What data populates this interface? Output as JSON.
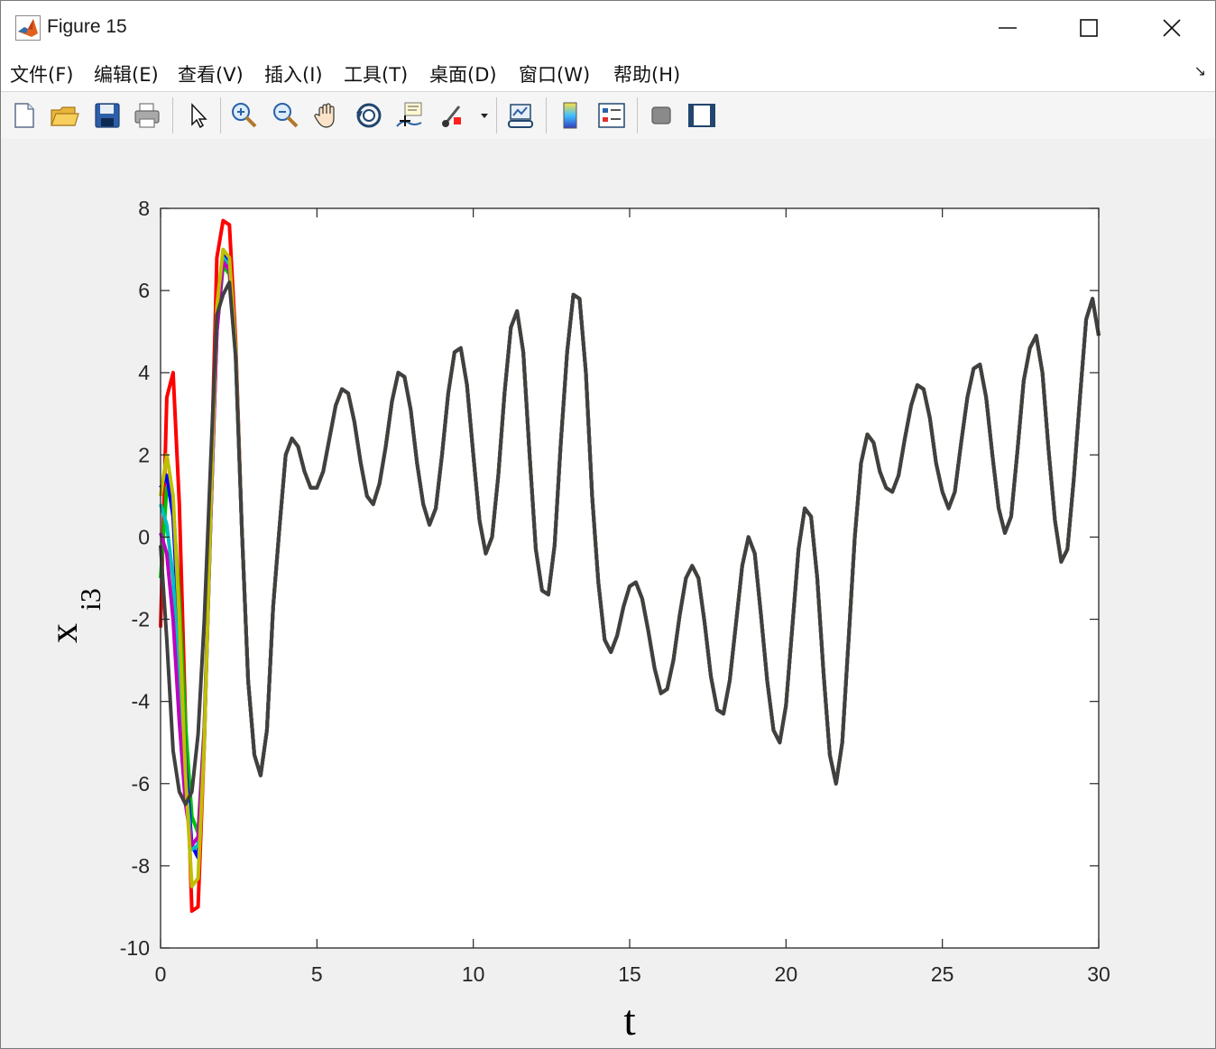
{
  "window": {
    "title": "Figure 15",
    "controls": {
      "minimize": "minimize-icon",
      "maximize": "maximize-icon",
      "close": "close-icon"
    }
  },
  "menu": {
    "items": [
      "文件(F)",
      "编辑(E)",
      "查看(V)",
      "插入(I)",
      "工具(T)",
      "桌面(D)",
      "窗口(W)",
      "帮助(H)"
    ],
    "corner_icon": "dock-arrow-icon"
  },
  "toolbar": {
    "tools": [
      "new-figure-icon",
      "open-file-icon",
      "save-icon",
      "print-icon",
      "select-arrow-icon",
      "zoom-in-icon",
      "zoom-out-icon",
      "pan-hand-icon",
      "rotate-3d-icon",
      "data-cursor-icon",
      "brush-icon",
      "link-plot-icon",
      "colorbar-icon",
      "legend-icon",
      "hide-plot-tools-icon",
      "show-plot-tools-icon"
    ]
  },
  "colors": {
    "axes_bg": "#ffffff",
    "window_bg": "#f0f0f0",
    "series": [
      "#ff0000",
      "#00c000",
      "#0000ff",
      "#00bfbf",
      "#bf00bf",
      "#bfbf00",
      "#404040"
    ]
  },
  "chart_data": {
    "type": "line",
    "title": "",
    "xlabel": "t",
    "ylabel_main": "x",
    "ylabel_sub": "i3",
    "xlim": [
      0,
      30
    ],
    "ylim": [
      -10,
      8
    ],
    "xticks": [
      0,
      5,
      10,
      15,
      20,
      25,
      30
    ],
    "yticks": [
      -10,
      -8,
      -6,
      -4,
      -2,
      0,
      2,
      4,
      6,
      8
    ],
    "grid": false,
    "x": [
      0.0,
      0.2,
      0.4,
      0.6,
      0.8,
      1.0,
      1.2,
      1.4,
      1.6,
      1.8,
      2.0,
      2.2,
      2.4,
      2.6,
      2.8,
      3.0,
      3.2,
      3.4,
      3.6,
      3.8,
      4.0,
      4.2,
      4.4,
      4.6,
      4.8,
      5.0,
      5.2,
      5.4,
      5.6,
      5.8,
      6.0,
      6.2,
      6.4,
      6.6,
      6.8,
      7.0,
      7.2,
      7.4,
      7.6,
      7.8,
      8.0,
      8.2,
      8.4,
      8.6,
      8.8,
      9.0,
      9.2,
      9.4,
      9.6,
      9.8,
      10.0,
      10.2,
      10.4,
      10.6,
      10.8,
      11.0,
      11.2,
      11.4,
      11.6,
      11.8,
      12.0,
      12.2,
      12.4,
      12.6,
      12.8,
      13.0,
      13.2,
      13.4,
      13.6,
      13.8,
      14.0,
      14.2,
      14.4,
      14.6,
      14.8,
      15.0,
      15.2,
      15.4,
      15.6,
      15.8,
      16.0,
      16.2,
      16.4,
      16.6,
      16.8,
      17.0,
      17.2,
      17.4,
      17.6,
      17.8,
      18.0,
      18.2,
      18.4,
      18.6,
      18.8,
      19.0,
      19.2,
      19.4,
      19.6,
      19.8,
      20.0,
      20.2,
      20.4,
      20.6,
      20.8,
      21.0,
      21.2,
      21.4,
      21.6,
      21.8,
      22.0,
      22.2,
      22.4,
      22.6,
      22.8,
      23.0,
      23.2,
      23.4,
      23.6,
      23.8,
      24.0,
      24.2,
      24.4,
      24.6,
      24.8,
      25.0,
      25.2,
      25.4,
      25.6,
      25.8,
      26.0,
      26.2,
      26.4,
      26.6,
      26.8,
      27.0,
      27.2,
      27.4,
      27.6,
      27.8,
      28.0,
      28.2,
      28.4,
      28.6,
      28.8,
      29.0,
      29.2,
      29.4,
      29.6,
      29.8,
      30.0
    ],
    "series": [
      {
        "values": [
          -2.2,
          3.4,
          4.0,
          0.8,
          -4.5,
          -9.1,
          -9.0,
          -5.0,
          1.0,
          6.8,
          7.7,
          7.6,
          4.8,
          0.2,
          -3.5,
          -5.3,
          -5.8,
          -4.7,
          -1.7,
          0.2,
          2.0,
          2.4,
          2.2,
          1.6,
          1.2,
          1.2,
          1.6,
          2.4,
          3.2,
          3.6,
          3.5,
          2.8,
          1.8,
          1.0,
          0.8,
          1.3,
          2.2,
          3.3,
          4.0,
          3.9,
          3.1,
          1.8,
          0.8,
          0.3,
          0.7,
          2.0,
          3.5,
          4.5,
          4.6,
          3.7,
          2.0,
          0.4,
          -0.4,
          0.0,
          1.5,
          3.5,
          5.1,
          5.5,
          4.5,
          2.0,
          -0.3,
          -1.3,
          -1.4,
          -0.2,
          2.3,
          4.5,
          5.9,
          5.8,
          4.0,
          1.0,
          -1.1,
          -2.5,
          -2.8,
          -2.4,
          -1.7,
          -1.2,
          -1.1,
          -1.5,
          -2.3,
          -3.2,
          -3.8,
          -3.7,
          -3.0,
          -1.9,
          -1.0,
          -0.7,
          -1.0,
          -2.1,
          -3.4,
          -4.2,
          -4.3,
          -3.5,
          -2.1,
          -0.7,
          0.0,
          -0.4,
          -1.9,
          -3.5,
          -4.7,
          -5.0,
          -4.1,
          -2.2,
          -0.3,
          0.7,
          0.5,
          -1.0,
          -3.3,
          -5.3,
          -6.0,
          -5.0,
          -2.5,
          0.0,
          1.8,
          2.5,
          2.3,
          1.6,
          1.2,
          1.1,
          1.5,
          2.4,
          3.2,
          3.7,
          3.6,
          2.9,
          1.8,
          1.1,
          0.7,
          1.1,
          2.3,
          3.4,
          4.1,
          4.2,
          3.4,
          2.0,
          0.7,
          0.1,
          0.5,
          2.1,
          3.8,
          4.6,
          4.9,
          4.0,
          2.1,
          0.4,
          -0.6,
          -0.3,
          1.4,
          3.4,
          5.3,
          5.8,
          4.9
        ]
      },
      {
        "values": [
          -1.0,
          1.2,
          0.8,
          -1.5,
          -4.6,
          -6.8,
          -7.2,
          -4.6,
          0.5,
          5.0,
          6.6,
          6.4,
          4.4,
          0.2,
          -3.5,
          -5.3,
          -5.8,
          -4.7,
          -1.7,
          0.2,
          2.0,
          2.4,
          2.2,
          1.6,
          1.2,
          1.2,
          1.6,
          2.4,
          3.2,
          3.6,
          3.5,
          2.8,
          1.8,
          1.0,
          0.8,
          1.3,
          2.2,
          3.3,
          4.0,
          3.9,
          3.1,
          1.8,
          0.8,
          0.3,
          0.7,
          2.0,
          3.5,
          4.5,
          4.6,
          3.7,
          2.0,
          0.4,
          -0.4,
          0.0,
          1.5,
          3.5,
          5.1,
          5.5,
          4.5,
          2.0,
          -0.3,
          -1.3,
          -1.4,
          -0.2,
          2.3,
          4.5,
          5.9,
          5.8,
          4.0,
          1.0,
          -1.1,
          -2.5,
          -2.8,
          -2.4,
          -1.7,
          -1.2,
          -1.1,
          -1.5,
          -2.3,
          -3.2,
          -3.8,
          -3.7,
          -3.0,
          -1.9,
          -1.0,
          -0.7,
          -1.0,
          -2.1,
          -3.4,
          -4.2,
          -4.3,
          -3.5,
          -2.1,
          -0.7,
          0.0,
          -0.4,
          -1.9,
          -3.5,
          -4.7,
          -5.0,
          -4.1,
          -2.2,
          -0.3,
          0.7,
          0.5,
          -1.0,
          -3.3,
          -5.3,
          -6.0,
          -5.0,
          -2.5,
          0.0,
          1.8,
          2.5,
          2.3,
          1.6,
          1.2,
          1.1,
          1.5,
          2.4,
          3.2,
          3.7,
          3.6,
          2.9,
          1.8,
          1.1,
          0.7,
          1.1,
          2.3,
          3.4,
          4.1,
          4.2,
          3.4,
          2.0,
          0.7,
          0.1,
          0.5,
          2.1,
          3.8,
          4.6,
          4.9,
          4.0,
          2.1,
          0.4,
          -0.6,
          -0.3,
          1.4,
          3.4,
          5.3,
          5.8,
          4.9
        ]
      },
      {
        "values": [
          1.2,
          1.5,
          0.5,
          -2.5,
          -5.5,
          -7.5,
          -7.8,
          -4.9,
          0.4,
          5.2,
          6.9,
          6.7,
          4.6,
          0.2,
          -3.5,
          -5.3,
          -5.8,
          -4.7,
          -1.7,
          0.2,
          2.0,
          2.4,
          2.2,
          1.6,
          1.2,
          1.2,
          1.6,
          2.4,
          3.2,
          3.6,
          3.5,
          2.8,
          1.8,
          1.0,
          0.8,
          1.3,
          2.2,
          3.3,
          4.0,
          3.9,
          3.1,
          1.8,
          0.8,
          0.3,
          0.7,
          2.0,
          3.5,
          4.5,
          4.6,
          3.7,
          2.0,
          0.4,
          -0.4,
          0.0,
          1.5,
          3.5,
          5.1,
          5.5,
          4.5,
          2.0,
          -0.3,
          -1.3,
          -1.4,
          -0.2,
          2.3,
          4.5,
          5.9,
          5.8,
          4.0,
          1.0,
          -1.1,
          -2.5,
          -2.8,
          -2.4,
          -1.7,
          -1.2,
          -1.1,
          -1.5,
          -2.3,
          -3.2,
          -3.8,
          -3.7,
          -3.0,
          -1.9,
          -1.0,
          -0.7,
          -1.0,
          -2.1,
          -3.4,
          -4.2,
          -4.3,
          -3.5,
          -2.1,
          -0.7,
          0.0,
          -0.4,
          -1.9,
          -3.5,
          -4.7,
          -5.0,
          -4.1,
          -2.2,
          -0.3,
          0.7,
          0.5,
          -1.0,
          -3.3,
          -5.3,
          -6.0,
          -5.0,
          -2.5,
          0.0,
          1.8,
          2.5,
          2.3,
          1.6,
          1.2,
          1.1,
          1.5,
          2.4,
          3.2,
          3.7,
          3.6,
          2.9,
          1.8,
          1.1,
          0.7,
          1.1,
          2.3,
          3.4,
          4.1,
          4.2,
          3.4,
          2.0,
          0.7,
          0.1,
          0.5,
          2.1,
          3.8,
          4.6,
          4.9,
          4.0,
          2.1,
          0.4,
          -0.6,
          -0.3,
          1.4,
          3.4,
          5.3,
          5.8,
          4.9
        ]
      },
      {
        "values": [
          0.8,
          0.3,
          -1.0,
          -3.5,
          -6.0,
          -7.6,
          -7.5,
          -4.8,
          0.4,
          5.1,
          6.8,
          6.6,
          4.5,
          0.2,
          -3.5,
          -5.3,
          -5.8,
          -4.7,
          -1.7,
          0.2,
          2.0,
          2.4,
          2.2,
          1.6,
          1.2,
          1.2,
          1.6,
          2.4,
          3.2,
          3.6,
          3.5,
          2.8,
          1.8,
          1.0,
          0.8,
          1.3,
          2.2,
          3.3,
          4.0,
          3.9,
          3.1,
          1.8,
          0.8,
          0.3,
          0.7,
          2.0,
          3.5,
          4.5,
          4.6,
          3.7,
          2.0,
          0.4,
          -0.4,
          0.0,
          1.5,
          3.5,
          5.1,
          5.5,
          4.5,
          2.0,
          -0.3,
          -1.3,
          -1.4,
          -0.2,
          2.3,
          4.5,
          5.9,
          5.8,
          4.0,
          1.0,
          -1.1,
          -2.5,
          -2.8,
          -2.4,
          -1.7,
          -1.2,
          -1.1,
          -1.5,
          -2.3,
          -3.2,
          -3.8,
          -3.7,
          -3.0,
          -1.9,
          -1.0,
          -0.7,
          -1.0,
          -2.1,
          -3.4,
          -4.2,
          -4.3,
          -3.5,
          -2.1,
          -0.7,
          0.0,
          -0.4,
          -1.9,
          -3.5,
          -4.7,
          -5.0,
          -4.1,
          -2.2,
          -0.3,
          0.7,
          0.5,
          -1.0,
          -3.3,
          -5.3,
          -6.0,
          -5.0,
          -2.5,
          0.0,
          1.8,
          2.5,
          2.3,
          1.6,
          1.2,
          1.1,
          1.5,
          2.4,
          3.2,
          3.7,
          3.6,
          2.9,
          1.8,
          1.1,
          0.7,
          1.1,
          2.3,
          3.4,
          4.1,
          4.2,
          3.4,
          2.0,
          0.7,
          0.1,
          0.5,
          2.1,
          3.8,
          4.6,
          4.9,
          4.0,
          2.1,
          0.4,
          -0.6,
          -0.3,
          1.4,
          3.4,
          5.3,
          5.8,
          4.9
        ]
      },
      {
        "values": [
          0.1,
          -0.4,
          -2.0,
          -4.5,
          -6.5,
          -7.5,
          -7.3,
          -4.7,
          0.4,
          5.0,
          6.7,
          6.5,
          4.5,
          0.2,
          -3.5,
          -5.3,
          -5.8,
          -4.7,
          -1.7,
          0.2,
          2.0,
          2.4,
          2.2,
          1.6,
          1.2,
          1.2,
          1.6,
          2.4,
          3.2,
          3.6,
          3.5,
          2.8,
          1.8,
          1.0,
          0.8,
          1.3,
          2.2,
          3.3,
          4.0,
          3.9,
          3.1,
          1.8,
          0.8,
          0.3,
          0.7,
          2.0,
          3.5,
          4.5,
          4.6,
          3.7,
          2.0,
          0.4,
          -0.4,
          0.0,
          1.5,
          3.5,
          5.1,
          5.5,
          4.5,
          2.0,
          -0.3,
          -1.3,
          -1.4,
          -0.2,
          2.3,
          4.5,
          5.9,
          5.8,
          4.0,
          1.0,
          -1.1,
          -2.5,
          -2.8,
          -2.4,
          -1.7,
          -1.2,
          -1.1,
          -1.5,
          -2.3,
          -3.2,
          -3.8,
          -3.7,
          -3.0,
          -1.9,
          -1.0,
          -0.7,
          -1.0,
          -2.1,
          -3.4,
          -4.2,
          -4.3,
          -3.5,
          -2.1,
          -0.7,
          0.0,
          -0.4,
          -1.9,
          -3.5,
          -4.7,
          -5.0,
          -4.1,
          -2.2,
          -0.3,
          0.7,
          0.5,
          -1.0,
          -3.3,
          -5.3,
          -6.0,
          -5.0,
          -2.5,
          0.0,
          1.8,
          2.5,
          2.3,
          1.6,
          1.2,
          1.1,
          1.5,
          2.4,
          3.2,
          3.7,
          3.6,
          2.9,
          1.8,
          1.1,
          0.7,
          1.1,
          2.3,
          3.4,
          4.1,
          4.2,
          3.4,
          2.0,
          0.7,
          0.1,
          0.5,
          2.1,
          3.8,
          4.6,
          4.9,
          4.0,
          2.1,
          0.4,
          -0.6,
          -0.3,
          1.4,
          3.4,
          5.3,
          5.8,
          4.9
        ]
      },
      {
        "values": [
          1.0,
          2.0,
          1.0,
          -2.0,
          -5.8,
          -8.5,
          -8.3,
          -5.0,
          0.6,
          5.6,
          7.0,
          6.8,
          4.6,
          0.2,
          -3.5,
          -5.3,
          -5.8,
          -4.7,
          -1.7,
          0.2,
          2.0,
          2.4,
          2.2,
          1.6,
          1.2,
          1.2,
          1.6,
          2.4,
          3.2,
          3.6,
          3.5,
          2.8,
          1.8,
          1.0,
          0.8,
          1.3,
          2.2,
          3.3,
          4.0,
          3.9,
          3.1,
          1.8,
          0.8,
          0.3,
          0.7,
          2.0,
          3.5,
          4.5,
          4.6,
          3.7,
          2.0,
          0.4,
          -0.4,
          0.0,
          1.5,
          3.5,
          5.1,
          5.5,
          4.5,
          2.0,
          -0.3,
          -1.3,
          -1.4,
          -0.2,
          2.3,
          4.5,
          5.9,
          5.8,
          4.0,
          1.0,
          -1.1,
          -2.5,
          -2.8,
          -2.4,
          -1.7,
          -1.2,
          -1.1,
          -1.5,
          -2.3,
          -3.2,
          -3.8,
          -3.7,
          -3.0,
          -1.9,
          -1.0,
          -0.7,
          -1.0,
          -2.1,
          -3.4,
          -4.2,
          -4.3,
          -3.5,
          -2.1,
          -0.7,
          0.0,
          -0.4,
          -1.9,
          -3.5,
          -4.7,
          -5.0,
          -4.1,
          -2.2,
          -0.3,
          0.7,
          0.5,
          -1.0,
          -3.3,
          -5.3,
          -6.0,
          -5.0,
          -2.5,
          0.0,
          1.8,
          2.5,
          2.3,
          1.6,
          1.2,
          1.1,
          1.5,
          2.4,
          3.2,
          3.7,
          3.6,
          2.9,
          1.8,
          1.1,
          0.7,
          1.1,
          2.3,
          3.4,
          4.1,
          4.2,
          3.4,
          2.0,
          0.7,
          0.1,
          0.5,
          2.1,
          3.8,
          4.6,
          4.9,
          4.0,
          2.1,
          0.4,
          -0.6,
          -0.3,
          1.4,
          3.4,
          5.3,
          5.8,
          4.9
        ]
      },
      {
        "values": [
          -0.2,
          -2.5,
          -5.2,
          -6.2,
          -6.5,
          -6.2,
          -4.8,
          -2.0,
          1.8,
          5.4,
          5.9,
          6.2,
          4.4,
          0.2,
          -3.5,
          -5.3,
          -5.8,
          -4.7,
          -1.7,
          0.2,
          2.0,
          2.4,
          2.2,
          1.6,
          1.2,
          1.2,
          1.6,
          2.4,
          3.2,
          3.6,
          3.5,
          2.8,
          1.8,
          1.0,
          0.8,
          1.3,
          2.2,
          3.3,
          4.0,
          3.9,
          3.1,
          1.8,
          0.8,
          0.3,
          0.7,
          2.0,
          3.5,
          4.5,
          4.6,
          3.7,
          2.0,
          0.4,
          -0.4,
          0.0,
          1.5,
          3.5,
          5.1,
          5.5,
          4.5,
          2.0,
          -0.3,
          -1.3,
          -1.4,
          -0.2,
          2.3,
          4.5,
          5.9,
          5.8,
          4.0,
          1.0,
          -1.1,
          -2.5,
          -2.8,
          -2.4,
          -1.7,
          -1.2,
          -1.1,
          -1.5,
          -2.3,
          -3.2,
          -3.8,
          -3.7,
          -3.0,
          -1.9,
          -1.0,
          -0.7,
          -1.0,
          -2.1,
          -3.4,
          -4.2,
          -4.3,
          -3.5,
          -2.1,
          -0.7,
          0.0,
          -0.4,
          -1.9,
          -3.5,
          -4.7,
          -5.0,
          -4.1,
          -2.2,
          -0.3,
          0.7,
          0.5,
          -1.0,
          -3.3,
          -5.3,
          -6.0,
          -5.0,
          -2.5,
          0.0,
          1.8,
          2.5,
          2.3,
          1.6,
          1.2,
          1.1,
          1.5,
          2.4,
          3.2,
          3.7,
          3.6,
          2.9,
          1.8,
          1.1,
          0.7,
          1.1,
          2.3,
          3.4,
          4.1,
          4.2,
          3.4,
          2.0,
          0.7,
          0.1,
          0.5,
          2.1,
          3.8,
          4.6,
          4.9,
          4.0,
          2.1,
          0.4,
          -0.6,
          -0.3,
          1.4,
          3.4,
          5.3,
          5.8,
          4.9
        ]
      }
    ]
  }
}
